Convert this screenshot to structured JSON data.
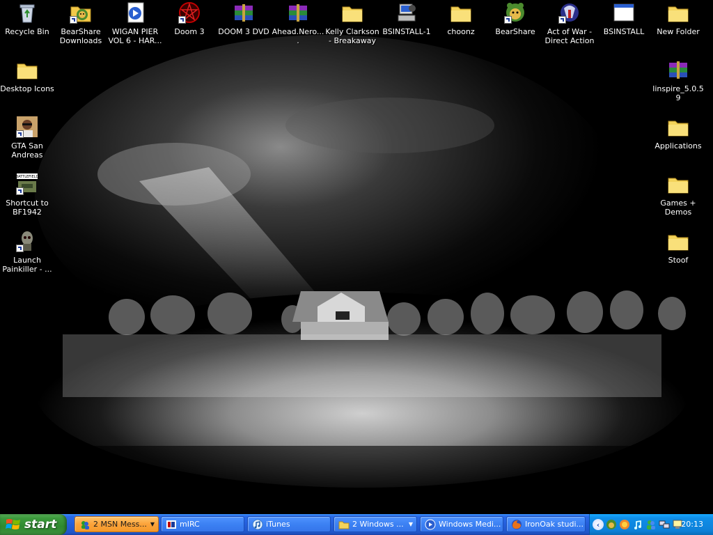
{
  "desktop": {
    "icons": [
      {
        "label": "Recycle Bin"
      },
      {
        "label": "BearShare Downloads"
      },
      {
        "label": "WIGAN PIER VOL 6 - HAR..."
      },
      {
        "label": "Doom 3"
      },
      {
        "label": "DOOM 3 DVD"
      },
      {
        "label": "Ahead.Nero...."
      },
      {
        "label": "Kelly Clarkson - Breakaway"
      },
      {
        "label": "BSINSTALL-1"
      },
      {
        "label": "choonz"
      },
      {
        "label": "BearShare"
      },
      {
        "label": "Act of War - Direct Action"
      },
      {
        "label": "BSINSTALL"
      },
      {
        "label": "New Folder"
      },
      {
        "label": "Desktop Icons"
      },
      {
        "label": "GTA San Andreas"
      },
      {
        "label": "Shortcut to BF1942"
      },
      {
        "label": "Launch Painkiller - ..."
      },
      {
        "label": "linspire_5.0.59"
      },
      {
        "label": "Applications"
      },
      {
        "label": "Games + Demos"
      },
      {
        "label": "Stoof"
      }
    ]
  },
  "taskbar": {
    "start_label": "start",
    "tasks": [
      {
        "label": "2 MSN Mess...",
        "group": true,
        "flashing": true
      },
      {
        "label": "mIRC",
        "group": false,
        "flashing": false
      },
      {
        "label": "iTunes",
        "group": false,
        "flashing": false
      },
      {
        "label": "2 Windows ...",
        "group": true,
        "flashing": false
      },
      {
        "label": "Windows Medi...",
        "group": false,
        "flashing": false
      },
      {
        "label": "IronOak studi...",
        "group": false,
        "flashing": false
      }
    ],
    "tray": {
      "clock": "20:13",
      "icons": [
        "expand-tray-icon",
        "bearshare-tray-icon",
        "firefox-tray-icon",
        "itunes-tray-icon",
        "msn-tray-icon",
        "network-tray-icon",
        "display-tray-icon"
      ]
    }
  },
  "colors": {
    "taskbar_blue": "#245edb",
    "start_green": "#3c9a3c",
    "tray_blue": "#0f8ee8",
    "flash_orange": "#fba33a"
  }
}
